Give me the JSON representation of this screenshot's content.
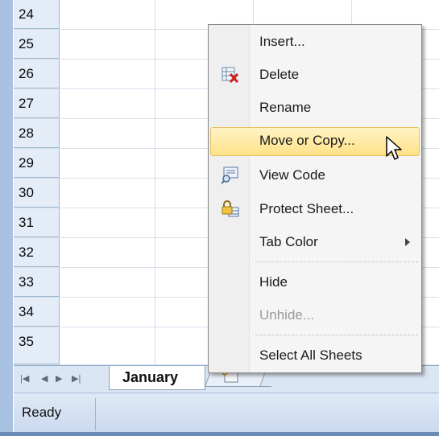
{
  "rows": [
    {
      "number": "24"
    },
    {
      "number": "25"
    },
    {
      "number": "26"
    },
    {
      "number": "27"
    },
    {
      "number": "28"
    },
    {
      "number": "29"
    },
    {
      "number": "30"
    },
    {
      "number": "31"
    },
    {
      "number": "32"
    },
    {
      "number": "33"
    },
    {
      "number": "34"
    },
    {
      "number": "35"
    }
  ],
  "sheet_tabs": {
    "active": "January"
  },
  "status": {
    "ready": "Ready"
  },
  "context_menu": {
    "items": [
      {
        "label": "Insert...",
        "icon": "",
        "enabled": true
      },
      {
        "label": "Delete",
        "icon": "delete-sheet-icon",
        "enabled": true
      },
      {
        "label": "Rename",
        "icon": "",
        "enabled": true
      },
      {
        "label": "Move or Copy...",
        "icon": "",
        "enabled": true,
        "highlighted": true
      },
      {
        "label": "View Code",
        "icon": "view-code-icon",
        "enabled": true
      },
      {
        "label": "Protect Sheet...",
        "icon": "protect-sheet-icon",
        "enabled": true
      },
      {
        "label": "Tab Color",
        "icon": "",
        "enabled": true,
        "submenu": true
      },
      {
        "label": "Hide",
        "icon": "",
        "enabled": true
      },
      {
        "label": "Unhide...",
        "icon": "",
        "enabled": false
      },
      {
        "label": "Select All Sheets",
        "icon": "",
        "enabled": true
      }
    ]
  },
  "colors": {
    "frame": "#a9c2e2",
    "row_header": "#e4ecf7",
    "menu_highlight": "#ffe188"
  }
}
